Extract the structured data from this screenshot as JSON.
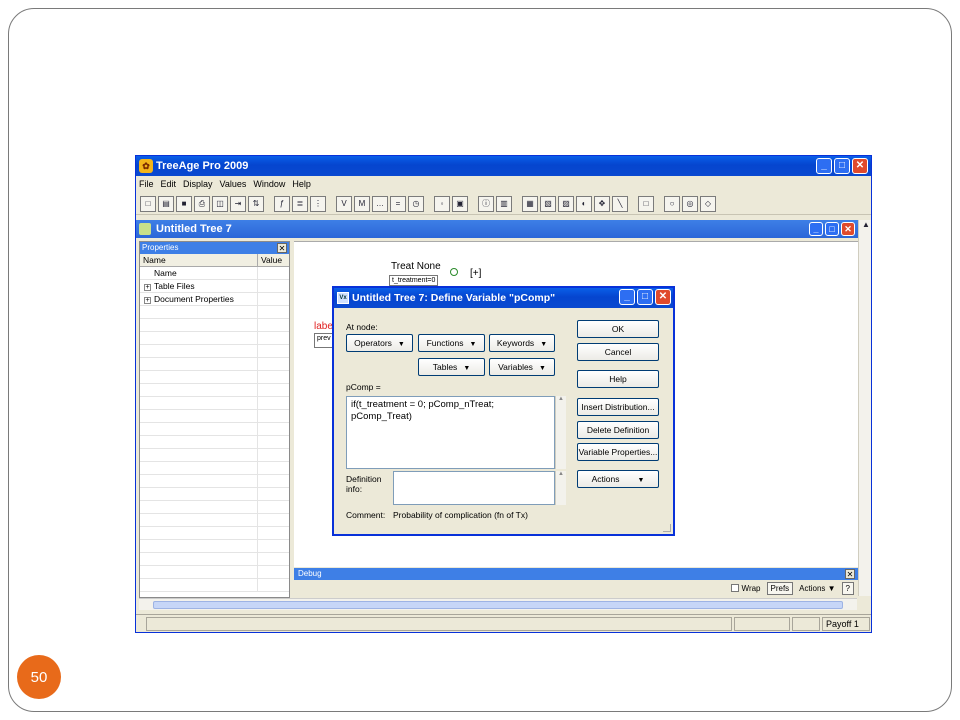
{
  "slide": {
    "page_number": "50"
  },
  "app": {
    "title": "TreeAge Pro 2009",
    "menu": [
      "File",
      "Edit",
      "Display",
      "Values",
      "Window",
      "Help"
    ],
    "toolbar_icons": [
      "new-icon",
      "open-icon",
      "save-icon",
      "print-icon",
      "print-preview-icon",
      "export-icon",
      "sort-icon",
      "formula-icon",
      "tree-icon",
      "variables-icon",
      "variable-define-icon",
      "markov-icon",
      "dots-icon",
      "equals-icon",
      "clock-icon",
      "node-icon",
      "report-icon",
      "info-icon",
      "chart-icon",
      "sensitivity-icon",
      "sensitivity-2way-icon",
      "tornado-icon",
      "cost-effectiveness-icon",
      "move-icon",
      "line-icon",
      "square-icon",
      "circle-icon",
      "chance-node-icon",
      "diamond-icon"
    ]
  },
  "tree_window": {
    "title": "Untitled Tree 7"
  },
  "properties": {
    "title": "Properties",
    "col_name": "Name",
    "col_value": "Value",
    "items": [
      {
        "label": "Name",
        "expand": ""
      },
      {
        "label": "Table Files",
        "expand": "+"
      },
      {
        "label": "Document Properties",
        "expand": "+"
      }
    ]
  },
  "canvas": {
    "node_treat_none": "Treat None",
    "node_plus": "[+]",
    "node_small": "t_treatment=0",
    "label_red": "labe",
    "label_prev": "prev"
  },
  "debug": {
    "title": "Debug",
    "wrap_label": "Wrap",
    "prefs_label": "Prefs",
    "actions_label": "Actions ▼",
    "help_label": "?"
  },
  "status": {
    "payoff": "Payoff 1"
  },
  "dialog": {
    "title": "Untitled Tree 7: Define Variable \"pComp\"",
    "at_node": "At node:",
    "operators": "Operators",
    "functions": "Functions",
    "keywords": "Keywords",
    "tables": "Tables",
    "variables": "Variables",
    "var_label": "pComp =",
    "formula": "if(t_treatment = 0; pComp_nTreat; pComp_Treat)",
    "definition_label": "Definition info:",
    "definition_value": "",
    "comment_label": "Comment:",
    "comment_value": "Probability of complication (fn of Tx)",
    "ok": "OK",
    "cancel": "Cancel",
    "help": "Help",
    "insert_distribution": "Insert Distribution...",
    "delete_definition": "Delete Definition",
    "variable_properties": "Variable Properties...",
    "actions": "Actions"
  }
}
